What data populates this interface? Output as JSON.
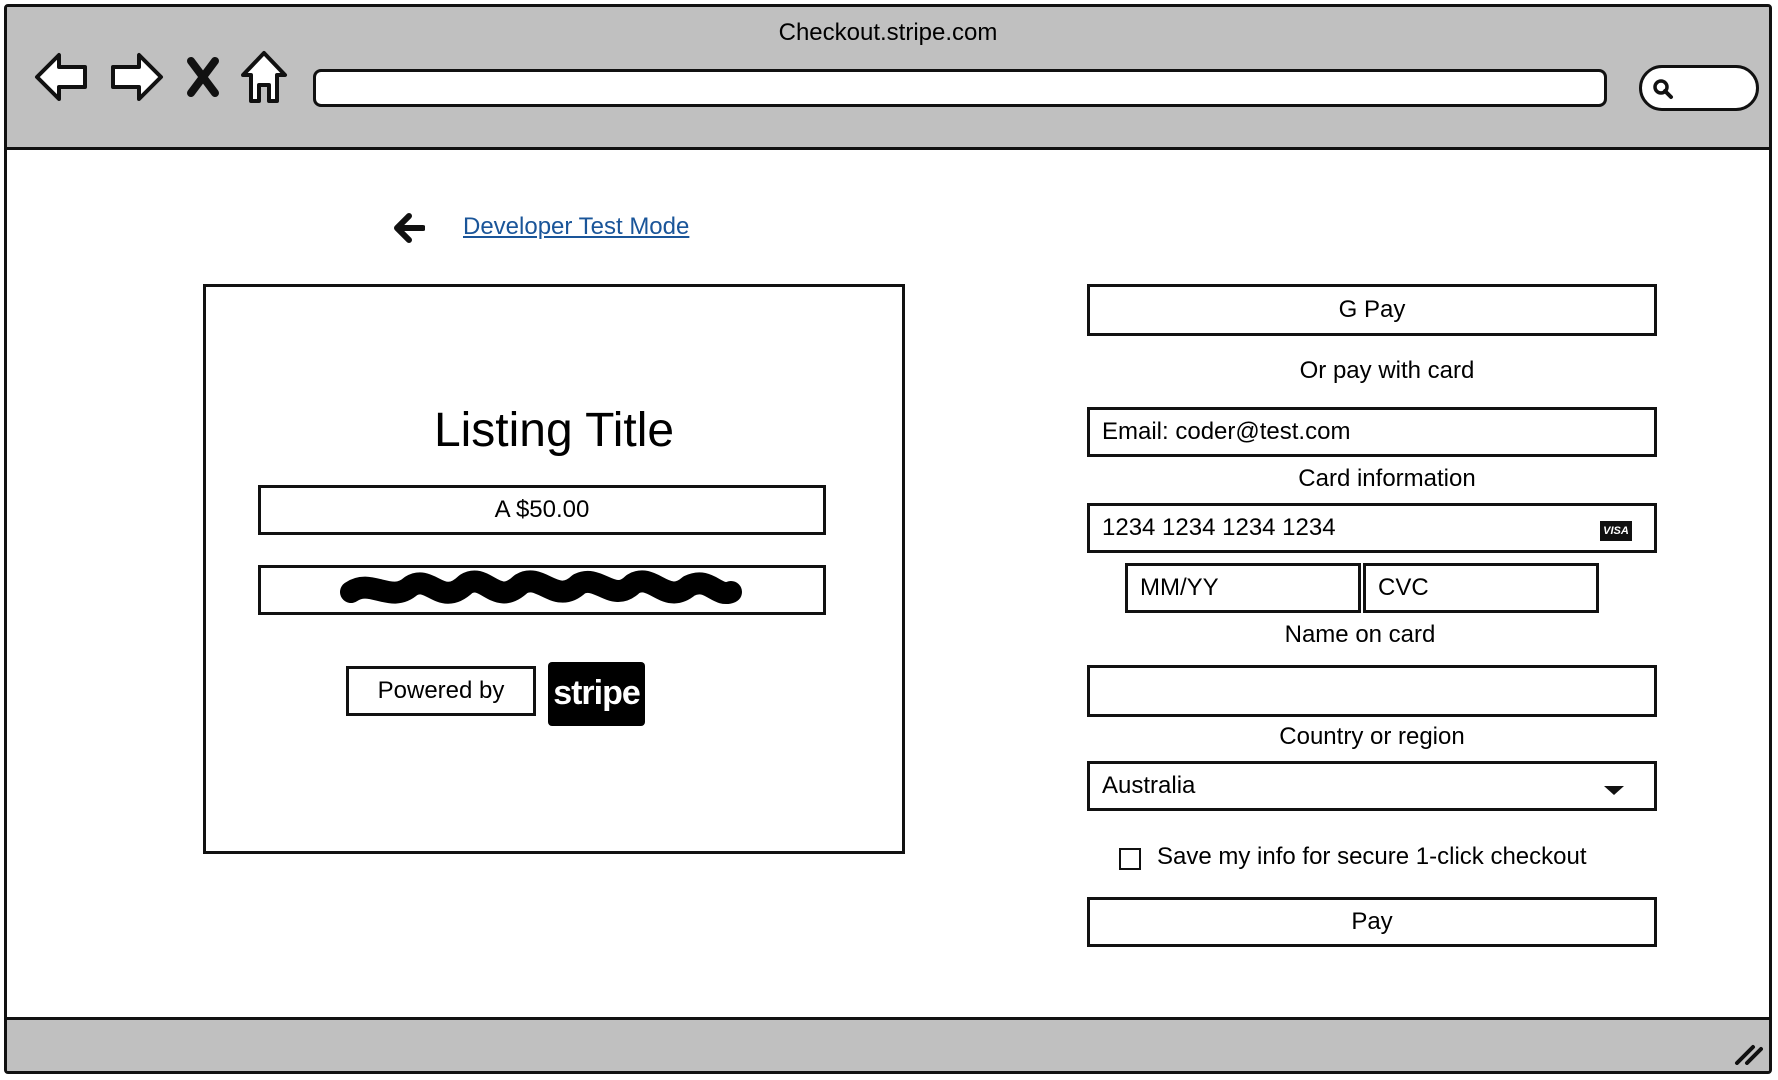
{
  "browser": {
    "title": "Checkout.stripe.com",
    "url": ""
  },
  "page": {
    "dev_link": "Developer Test Mode",
    "listing": {
      "title": "Listing Title",
      "price": "A $50.00",
      "powered_by": "Powered by",
      "brand": "stripe"
    },
    "payment": {
      "gpay_label": "G Pay",
      "or_pay_with_card": "Or pay with card",
      "email_value": "Email: coder@test.com",
      "card_info_label": "Card information",
      "card_number_value": "1234 1234 1234 1234",
      "card_brand": "VISA",
      "expiry_placeholder": "MM/YY",
      "cvc_placeholder": "CVC",
      "name_label": "Name on card",
      "name_value": "",
      "country_label": "Country or region",
      "country_value": "Australia",
      "save_info_label": "Save my info for secure 1-click checkout",
      "save_info_checked": false,
      "pay_label": "Pay"
    }
  },
  "icons": [
    "back-arrow-icon",
    "forward-arrow-icon",
    "close-icon",
    "home-icon",
    "search-icon",
    "left-arrow-icon",
    "chevron-down-icon",
    "resize-grip-icon"
  ]
}
